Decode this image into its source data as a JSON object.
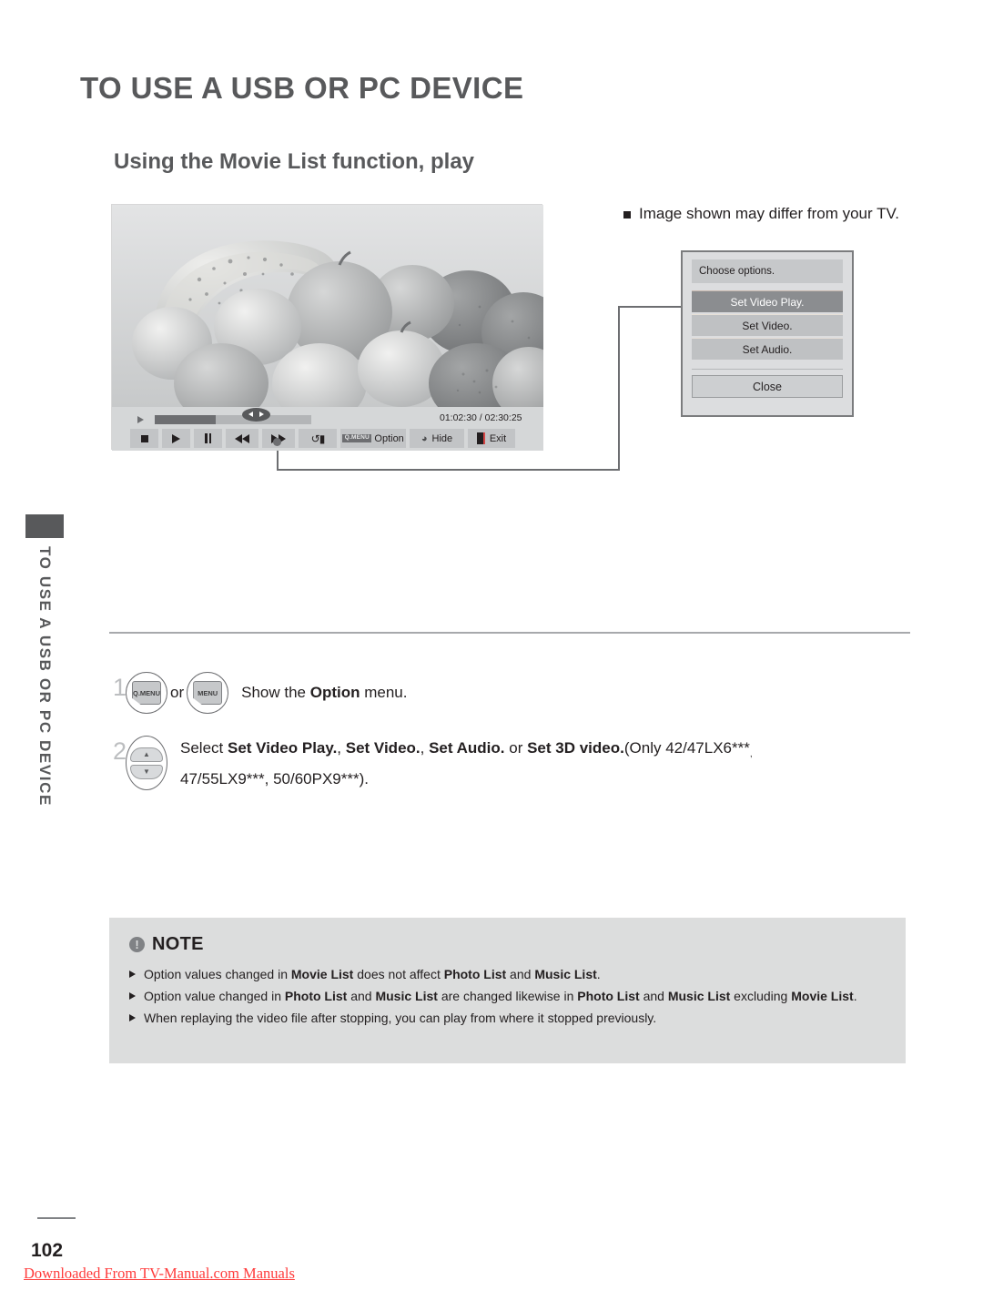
{
  "page": {
    "title": "TO USE A USB OR PC DEVICE",
    "section_title": "Using the Movie List function, play",
    "side_tab_label": "TO USE A USB OR PC DEVICE",
    "page_number": "102",
    "download_link": "Downloaded From TV-Manual.com Manuals",
    "accent_color": "#58595b",
    "note_bg_color": "#dcdddd",
    "link_color": "#ff3b3b"
  },
  "figure": {
    "caption": "Image shown may differ from your TV.",
    "caption_bullet": "square-bullet",
    "photo_alt": "grayscale-fruit-bowl"
  },
  "player": {
    "time_display": "01:02:30 / 02:30:25",
    "progress_percent": 39,
    "buttons": [
      {
        "name": "stop-button",
        "icon": "stop-icon",
        "label": ""
      },
      {
        "name": "play-button",
        "icon": "play-icon",
        "label": ""
      },
      {
        "name": "pause-button",
        "icon": "pause-icon",
        "label": ""
      },
      {
        "name": "rewind-button",
        "icon": "rewind-icon",
        "label": ""
      },
      {
        "name": "fast-forward-button",
        "icon": "fast-forward-icon",
        "label": ""
      },
      {
        "name": "repeat-button",
        "icon": "repeat-icon",
        "label": ""
      },
      {
        "name": "option-button",
        "icon": "qmenu-badge",
        "badge": "Q.MENU",
        "label": "Option"
      },
      {
        "name": "hide-button",
        "icon": "hide-icon",
        "label": "Hide"
      },
      {
        "name": "exit-button",
        "icon": "exit-icon",
        "label": "Exit"
      }
    ]
  },
  "osd_dialog": {
    "title": "Choose options.",
    "items": [
      {
        "label": "Set Video Play.",
        "selected": true
      },
      {
        "label": "Set Video.",
        "selected": false
      },
      {
        "label": "Set Audio.",
        "selected": false
      }
    ],
    "close_label": "Close"
  },
  "steps": [
    {
      "number": "1",
      "key_primary": "Q.MENU",
      "or_text": "or",
      "key_secondary": "MENU",
      "text_before": "Show the ",
      "text_bold": "Option",
      "text_after": " menu."
    },
    {
      "number": "2",
      "key_icon": "up-down-rocker-icon",
      "line1_prefix": "Select ",
      "line1_bold_1": "Set Video Play.",
      "line1_sep_1": ", ",
      "line1_bold_2": "Set Video.",
      "line1_sep_2": ", ",
      "line1_bold_3": "Set Audio.",
      "line1_sep_3": " or ",
      "line1_bold_4": "Set 3D video.",
      "line1_suffix": "(Only 42/47LX6***",
      "line1_sup": ",",
      "line2": "47/55LX9***, 50/60PX9***)."
    }
  ],
  "note": {
    "title": "NOTE",
    "icon": "exclamation-icon",
    "items": [
      {
        "parts": [
          {
            "t": "Option values changed in ",
            "b": false
          },
          {
            "t": "Movie List",
            "b": true
          },
          {
            "t": " does not affect ",
            "b": false
          },
          {
            "t": "Photo List",
            "b": true
          },
          {
            "t": " and ",
            "b": false
          },
          {
            "t": "Music List",
            "b": true
          },
          {
            "t": ".",
            "b": false
          }
        ]
      },
      {
        "parts": [
          {
            "t": "Option value changed in ",
            "b": false
          },
          {
            "t": "Photo List",
            "b": true
          },
          {
            "t": " and ",
            "b": false
          },
          {
            "t": "Music List",
            "b": true
          },
          {
            "t": " are changed likewise in ",
            "b": false
          },
          {
            "t": "Photo List",
            "b": true
          },
          {
            "t": " and ",
            "b": false
          },
          {
            "t": "Music List",
            "b": true
          },
          {
            "t": " excluding ",
            "b": false
          },
          {
            "t": "Movie List",
            "b": true
          },
          {
            "t": ".",
            "b": false
          }
        ]
      },
      {
        "parts": [
          {
            "t": "When replaying the video file after stopping, you can play from where it stopped previously.",
            "b": false
          }
        ]
      }
    ]
  }
}
